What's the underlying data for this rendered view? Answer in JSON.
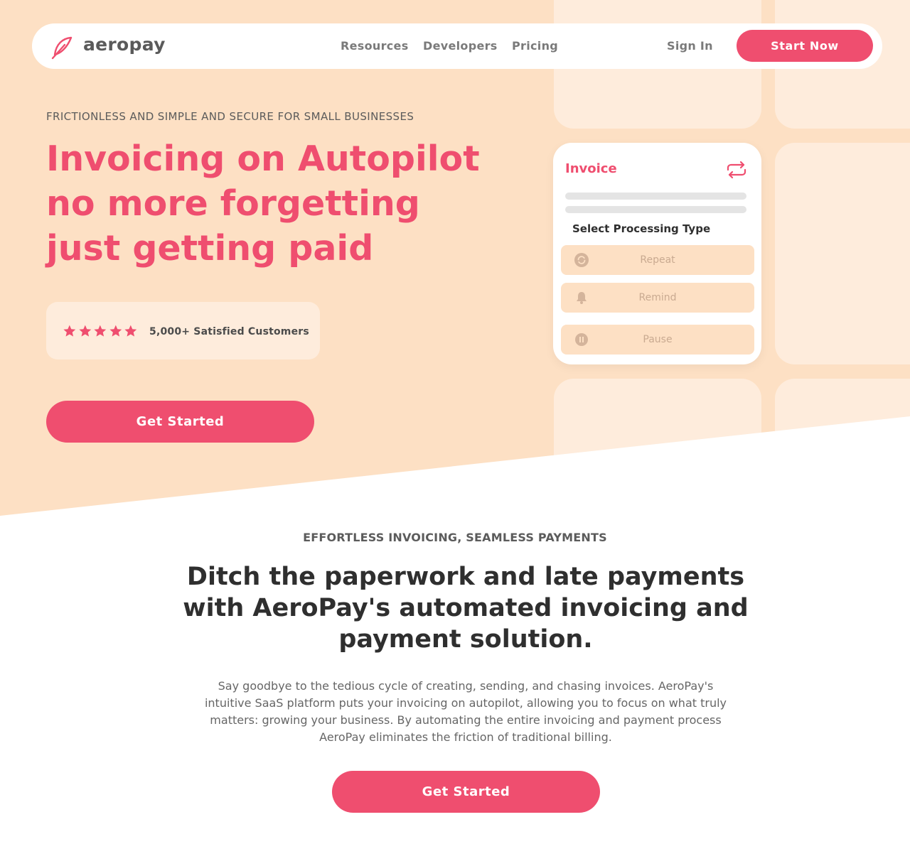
{
  "brand": {
    "name": "aeropay",
    "accent": "#ef4e6f",
    "hero_bg": "#fde0c4",
    "tile_bg": "#feecdc"
  },
  "nav": {
    "links": [
      "Resources",
      "Developers",
      "Pricing"
    ],
    "sign_in": "Sign In",
    "start_now": "Start Now"
  },
  "hero": {
    "eyebrow": "FRICTIONLESS AND SIMPLE AND SECURE FOR SMALL BUSINESSES",
    "headline_lines": [
      "Invoicing on Autopilot",
      "no more forgetting",
      "just getting paid"
    ],
    "rating": {
      "stars": 5,
      "text": "5,000+ Satisfied Customers"
    },
    "cta": "Get Started"
  },
  "invoice_card": {
    "title": "Invoice",
    "header_icon": "repeat-icon",
    "subtitle": "Select Processing Type",
    "options": [
      {
        "label": "Repeat",
        "icon": "sync-icon"
      },
      {
        "label": "Remind",
        "icon": "bell-icon"
      },
      {
        "label": "Pause",
        "icon": "pause-icon"
      }
    ]
  },
  "section": {
    "eyebrow": "EFFORTLESS INVOICING, SEAMLESS PAYMENTS",
    "title": "Ditch the paperwork and late payments with AeroPay's automated invoicing and payment solution.",
    "body": "Say goodbye to the tedious cycle of creating, sending, and chasing invoices. AeroPay's intuitive SaaS platform puts your invoicing on autopilot, allowing you to focus on what truly matters: growing your business. By automating the entire invoicing and payment process AeroPay eliminates the friction of traditional billing.",
    "cta": "Get Started"
  }
}
